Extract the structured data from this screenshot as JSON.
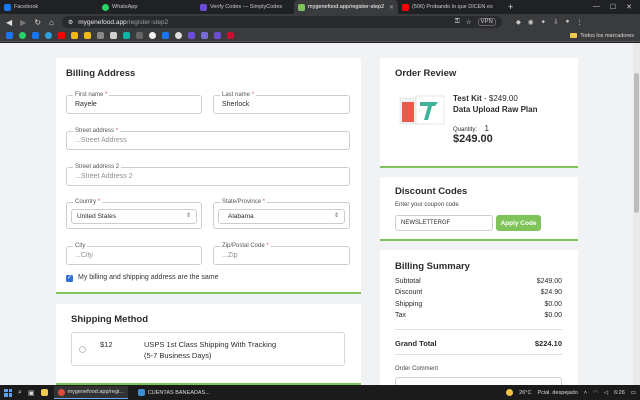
{
  "browser": {
    "tabs": [
      {
        "title": "Facebook",
        "color": "#1877f2",
        "active": false
      },
      {
        "title": "WhatsApp",
        "color": "#25d366",
        "active": false
      },
      {
        "title": "Verify Codes — SimplyCodes",
        "color": "#6c4cd9",
        "active": false
      },
      {
        "title": "mygenefood.app/register-step2",
        "color": "#7fc35b",
        "active": true
      },
      {
        "title": "(506) Probando lo que DICEN es",
        "color": "#ff0000",
        "active": false
      }
    ],
    "new_tab": "+",
    "url_host": "mygenefood.app",
    "url_path": "/register-step2",
    "vpn_label": "VPN",
    "bookmarks_folder": "Todos los marcadores"
  },
  "billing": {
    "title": "Billing Address",
    "first_name": {
      "label": "First name",
      "value": "Rayele"
    },
    "last_name": {
      "label": "Last name",
      "value": "Sherlock"
    },
    "street1": {
      "label": "Street address",
      "placeholder": "...Street Address"
    },
    "street2": {
      "label": "Street address 2",
      "placeholder": "...Street Address 2"
    },
    "country": {
      "label": "Country",
      "value": "United States"
    },
    "state": {
      "label": "State/Province",
      "value": "Alabama"
    },
    "city": {
      "label": "City",
      "placeholder": "...City"
    },
    "zip": {
      "label": "Zip/Postal Code",
      "placeholder": "...Zip"
    },
    "same_address_label": "My billing and shipping address are the same",
    "required_mark": "*"
  },
  "shipping": {
    "title": "Shipping Method",
    "option": {
      "price": "$12",
      "name": "USPS 1st Class Shipping With Tracking",
      "eta": "(5-7 Business Days)"
    }
  },
  "order_review": {
    "title": "Order Review",
    "product_name": "Test Kit",
    "product_price": "- $249.00",
    "plan": "Data Upload Raw Plan",
    "quantity_label": "Quantity:",
    "quantity": "1",
    "total": "$249.00"
  },
  "discount": {
    "title": "Discount Codes",
    "prompt": "Enter your coupon code",
    "code": "NEWSLETTERGF",
    "apply_label": "Apply Code"
  },
  "summary": {
    "title": "Billing Summary",
    "rows": [
      {
        "label": "Subtotal",
        "value": "$249.00"
      },
      {
        "label": "Discount",
        "value": "$24.90"
      },
      {
        "label": "Shipping",
        "value": "$0.00"
      },
      {
        "label": "Tax",
        "value": "$0.00"
      }
    ],
    "grand_label": "Grand Total",
    "grand_value": "$224.10",
    "comment_label": "Order Comment"
  },
  "taskbar": {
    "items": [
      {
        "label": "mygenefood.app/regi...",
        "color": "#7fc35b"
      },
      {
        "label": "CUENTAS BANEADAS...",
        "color": "#3d8fd6"
      }
    ],
    "temperature": "26°C",
    "weather": "Pcial. despejado",
    "time": "6:26"
  },
  "colors": {
    "accent": "#7fc35b",
    "checkbox": "#2f6fd6",
    "required": "#e04b4b"
  }
}
